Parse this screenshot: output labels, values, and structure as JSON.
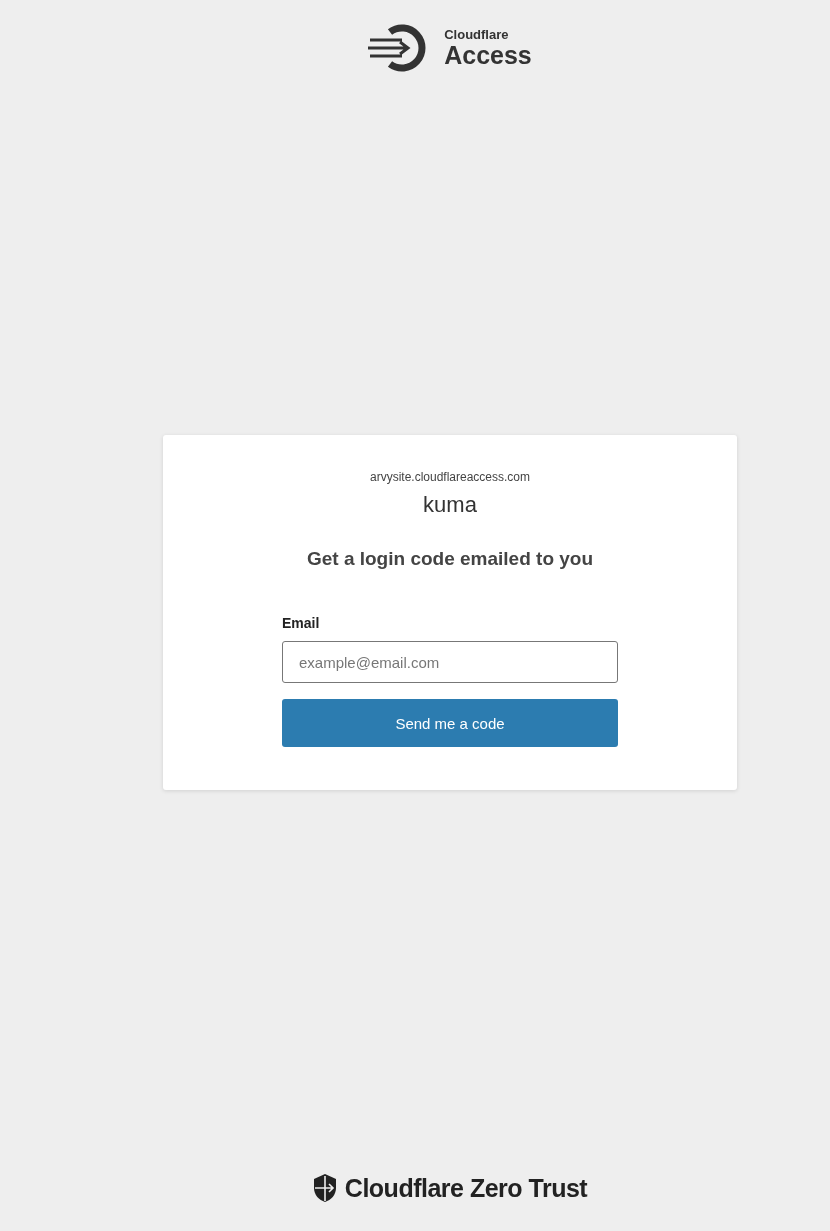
{
  "header": {
    "brand_small": "Cloudflare",
    "brand_large": "Access"
  },
  "card": {
    "domain": "arvysite.cloudflareaccess.com",
    "app_name": "kuma",
    "heading": "Get a login code emailed to you",
    "email_label": "Email",
    "email_field": {
      "placeholder": "example@email.com"
    },
    "submit_button": "Send me a code"
  },
  "footer": {
    "brand": "Cloudflare Zero Trust"
  }
}
